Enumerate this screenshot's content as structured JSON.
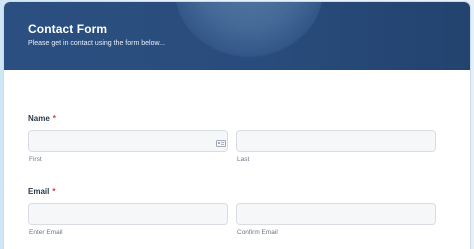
{
  "header": {
    "title": "Contact Form",
    "subtitle": "Please get in contact using the form below..."
  },
  "name": {
    "label": "Name",
    "required_mark": "*",
    "first": {
      "value": "",
      "placeholder": "",
      "sublabel": "First"
    },
    "last": {
      "value": "",
      "placeholder": "",
      "sublabel": "Last"
    }
  },
  "email": {
    "label": "Email",
    "required_mark": "*",
    "enter": {
      "value": "",
      "placeholder": "",
      "sublabel": "Enter Email"
    },
    "confirm": {
      "value": "",
      "placeholder": "",
      "sublabel": "Confirm Email"
    }
  },
  "icons": {
    "autofill": "contact-card-icon"
  },
  "colors": {
    "header_bg": "#2b4f80",
    "required": "#dd3333",
    "field_bg": "#f6f7f9"
  }
}
